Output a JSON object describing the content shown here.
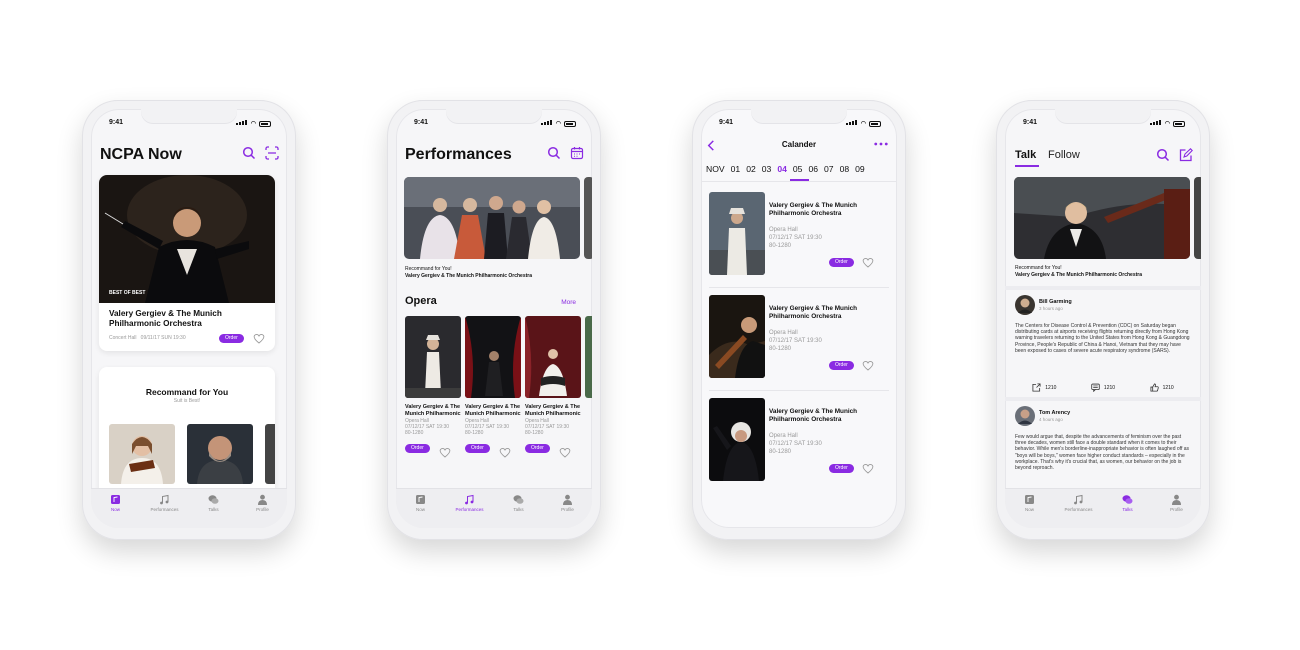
{
  "status_time": "9:41",
  "tabs": [
    "Now",
    "Performances",
    "Talks",
    "Profile"
  ],
  "order_label": "Order",
  "accent": "#8a2be2",
  "screen1": {
    "title": "NCPA Now",
    "badge": "BEST OF BEST",
    "event_title": "Valery Gergiev & The Munich Philharmonic Orchestra",
    "event_meta": "Concert Hall   09/11/17 SUN 19:30",
    "recommend_title": "Recommand for You",
    "recommend_sub": "Suit is Best!"
  },
  "screen2": {
    "title": "Performances",
    "hero_caption_1": "Recommand for You!",
    "hero_caption_2": "Valery Gergiev & The Munich Philharmonic Orchestra",
    "section_title": "Opera",
    "more_label": "More",
    "cards": [
      {
        "name": "Valery Gergiev & The Munich Philharmonic",
        "venue": "Opera Hall",
        "date": "07/12/17 SAT 19:30",
        "price": "80-1280"
      },
      {
        "name": "Valery Gergiev & The Munich Philharmonic",
        "venue": "Opera Hall",
        "date": "07/12/17 SAT 19:30",
        "price": "80-1280"
      },
      {
        "name": "Valery Gergiev & The Munich Philharmonic",
        "venue": "Opera Hall",
        "date": "07/12/17 SAT 19:30",
        "price": "80-1280"
      }
    ]
  },
  "screen3": {
    "title": "Calander",
    "month": "NOV",
    "days": [
      "01",
      "02",
      "03",
      "04",
      "05",
      "06",
      "07",
      "08",
      "09"
    ],
    "active_day": "04",
    "items": [
      {
        "name": "Valery Gergiev & The Munich Philharmonic Orchestra",
        "venue": "Opera Hall",
        "date": "07/12/17 SAT 19:30",
        "price": "80-1280"
      },
      {
        "name": "Valery Gergiev & The Munich Philharmonic Orchestra",
        "venue": "Opera Hall",
        "date": "07/12/17 SAT 19:30",
        "price": "80-1280"
      },
      {
        "name": "Valery Gergiev & The Munich Philharmonic Orchestra",
        "venue": "Opera Hall",
        "date": "07/12/17 SAT 19:30",
        "price": "80-1280"
      }
    ]
  },
  "screen4": {
    "tab_talk": "Talk",
    "tab_follow": "Follow",
    "hero_caption_1": "Recommand for You!",
    "hero_caption_2": "Valery Gergiev & The Munich Philharmonic Orchestra",
    "posts": [
      {
        "user": "Bill Garming",
        "time": "3 hours ago",
        "body": "The Centers for Disease Control & Prevention (CDC) on Saturday began distributing cards at airports receiving flights returning directly from Hong Kong warning travelers returning to the United States from Hong Kong & Guangdong Province, People's Republic of China & Hanoi, Vietnam that they may have been exposed to cases of severe acute respiratory syndrome (SARS).",
        "shares": "1210",
        "comments": "1210",
        "likes": "1210"
      },
      {
        "user": "Tom Arency",
        "time": "4 hours ago",
        "body": "Few would argue that, despite the advancements of feminism over the past three decades, women still face a double standard when it comes to their behavior. While men's borderline-inappropriate behavior is often laughed off as \"boys will be boys,\" women face higher conduct standards – especially in the workplace. That's why it's crucial that, as women, our behavior on the job is beyond reproach."
      }
    ]
  }
}
